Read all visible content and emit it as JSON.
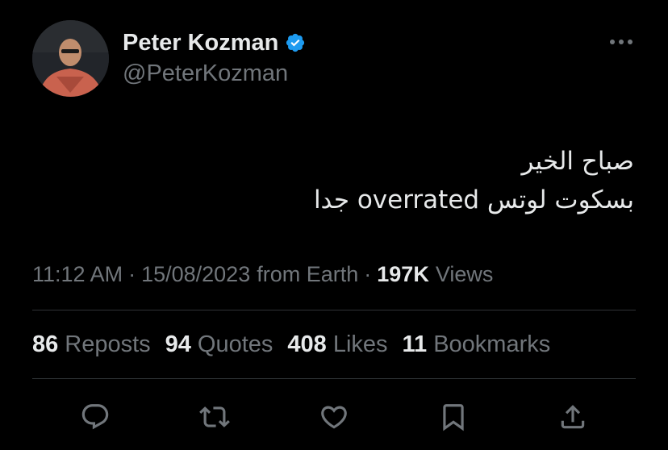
{
  "user": {
    "name": "Peter Kozman",
    "handle": "@PeterKozman",
    "verified": true
  },
  "tweet": {
    "lines": [
      "صباح الخير",
      "بسكوت لوتس overrated جدا"
    ]
  },
  "meta": {
    "time": "11:12 AM",
    "date": "15/08/2023",
    "source": "from Earth",
    "views_count": "197K",
    "views_label": "Views"
  },
  "stats": [
    {
      "count": "86",
      "label": "Reposts"
    },
    {
      "count": "94",
      "label": "Quotes"
    },
    {
      "count": "408",
      "label": "Likes"
    },
    {
      "count": "11",
      "label": "Bookmarks"
    }
  ],
  "actions": [
    "reply-icon",
    "repost-icon",
    "like-icon",
    "bookmark-icon",
    "share-icon"
  ],
  "colors": {
    "background": "#000000",
    "text_primary": "#e7e9ea",
    "text_secondary": "#71767b",
    "verified_blue": "#1d9bf0",
    "divider": "#2f3336"
  }
}
